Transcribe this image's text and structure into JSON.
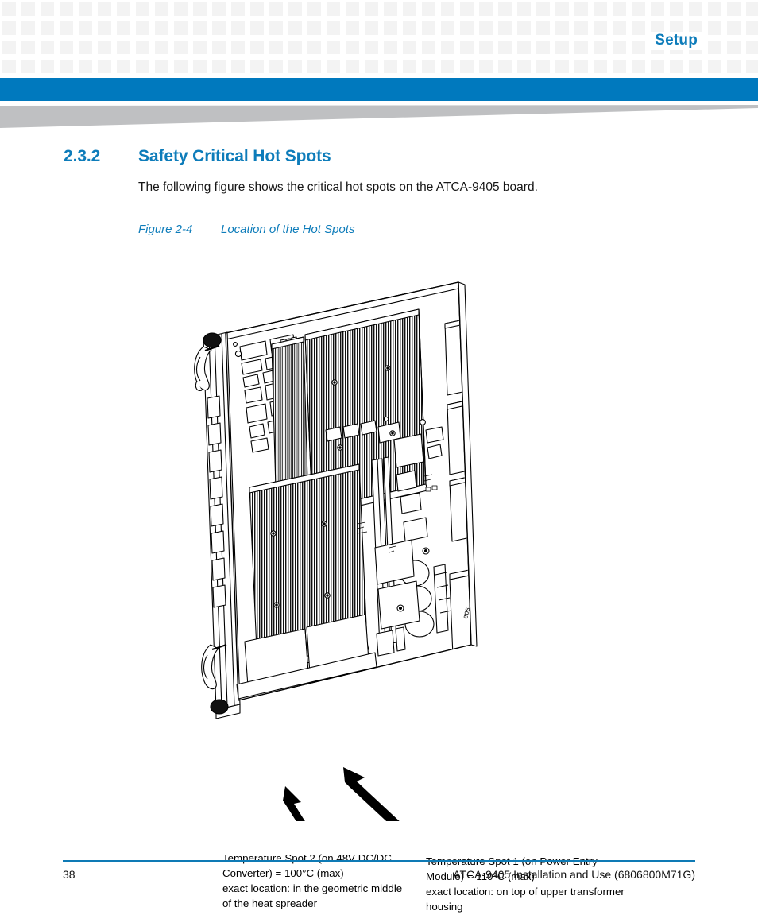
{
  "header": {
    "title": "Setup",
    "accent_color": "#0079be",
    "grid_square_color": "#f3f3f3",
    "wedge_color": "#bfc0c2"
  },
  "section": {
    "number": "2.3.2",
    "title": "Safety Critical Hot Spots",
    "body": "The following figure shows the critical hot spots on the ATCA-9405 board."
  },
  "figure": {
    "label": "Figure 2-4",
    "caption": "Location of the Hot Spots",
    "alt_name": "atca-9405-board-isometric-line-drawing"
  },
  "annotations": [
    {
      "name": "temperature-spot-2",
      "line1": "Temperature Spot 2 (on 48V DC/DC",
      "line2": "Converter) = 100°C (max)",
      "line3": "exact location: in the geometric middle",
      "line4": "of the heat spreader"
    },
    {
      "name": "temperature-spot-1",
      "line1": "Temperature Spot 1 (on Power Entry",
      "line2": "Module) = 110°C (max)",
      "line3": "exact location: on top of upper transformer",
      "line4": "housing"
    }
  ],
  "footer": {
    "page_number": "38",
    "document_title": "ATCA-9405 Installation and Use (6806800M71G)",
    "rule_color": "#0e7ab5"
  }
}
